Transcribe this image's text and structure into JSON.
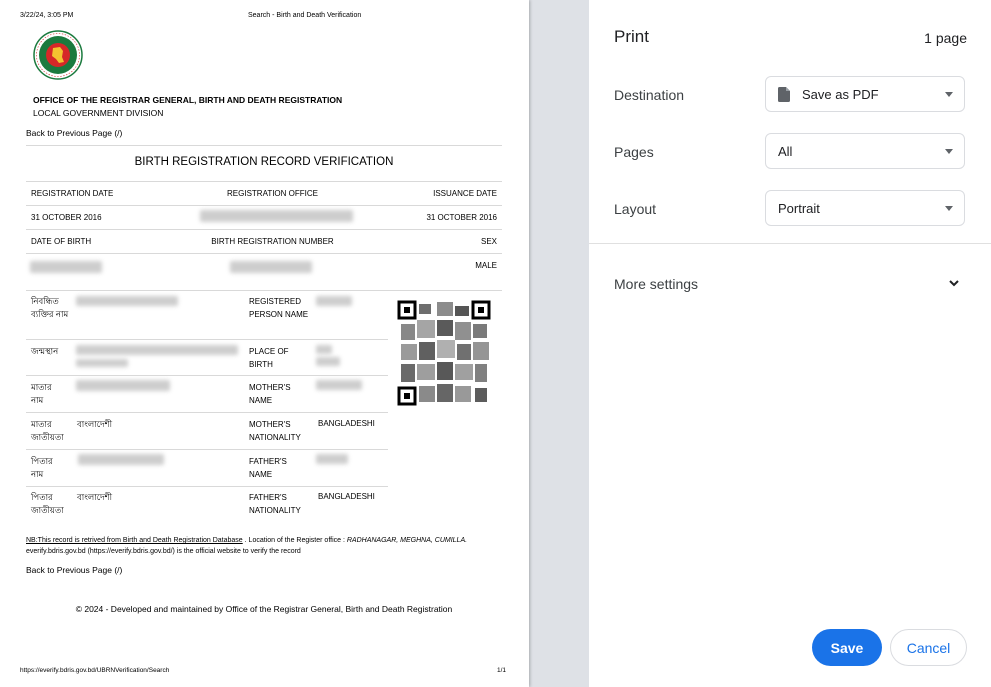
{
  "page": {
    "header_date": "3/22/24, 3:05 PM",
    "header_title": "Search - Birth and Death Verification",
    "office_title": "OFFICE OF THE REGISTRAR GENERAL, BIRTH AND DEATH REGISTRATION",
    "office_sub": "LOCAL GOVERNMENT DIVISION",
    "back_link": "Back to Previous Page (/)",
    "record_title": "BIRTH REGISTRATION RECORD VERIFICATION",
    "headers": {
      "registration_date": "REGISTRATION DATE",
      "registration_office": "REGISTRATION OFFICE",
      "issuance_date": "ISSUANCE DATE",
      "date_of_birth": "DATE OF BIRTH",
      "birth_reg_number": "BIRTH REGISTRATION NUMBER",
      "sex": "SEX"
    },
    "values": {
      "registration_date": "31 OCTOBER 2016",
      "issuance_date": "31 OCTOBER 2016",
      "sex": "MALE"
    },
    "details": [
      {
        "bn_label": "নিবন্ধিত ব্যক্তির নাম",
        "bn_value": "",
        "en_label": "REGISTERED PERSON NAME",
        "en_value": ""
      },
      {
        "bn_label": "জন্মস্থান",
        "bn_value": "",
        "en_label": "PLACE OF BIRTH",
        "en_value": ""
      },
      {
        "bn_label": "মাতার নাম",
        "bn_value": "",
        "en_label": "MOTHER'S NAME",
        "en_value": ""
      },
      {
        "bn_label": "মাতার জাতীয়তা",
        "bn_value": "বাংলাদেশী",
        "en_label": "MOTHER'S NATIONALITY",
        "en_value": "BANGLADESHI"
      },
      {
        "bn_label": "পিতার নাম",
        "bn_value": "",
        "en_label": "FATHER'S NAME",
        "en_value": ""
      },
      {
        "bn_label": "পিতার জাতীয়তা",
        "bn_value": "বাংলাদেশী",
        "en_label": "FATHER'S NATIONALITY",
        "en_value": "BANGLADESHI"
      }
    ],
    "nb_underlined": "NB:This record is retrived from Birth and Death Registration Database",
    "nb_mid": ". Location of the Register office :",
    "nb_location": "RADHANAGAR, MEGHNA, CUMILLA.",
    "nb_end": "everify.bdris.gov.bd (https://everify.bdris.gov.bd/) is the official website to verify the record",
    "back_link_bottom": "Back to Previous Page (/)",
    "copyright": "© 2024 - Developed and maintained by Office of the Registrar General, Birth and Death Registration",
    "footer_url": "https://everify.bdris.gov.bd/UBRNVerification/Search",
    "footer_page": "1/1"
  },
  "panel": {
    "title": "Print",
    "page_count": "1 page",
    "destination_label": "Destination",
    "destination_value": "Save as PDF",
    "pages_label": "Pages",
    "pages_value": "All",
    "layout_label": "Layout",
    "layout_value": "Portrait",
    "more_settings": "More settings",
    "save": "Save",
    "cancel": "Cancel"
  },
  "colors": {
    "accent": "#1a73e8",
    "preview_bg": "#dee1e6",
    "logo_green": "#1b7a3e",
    "logo_red": "#d62828"
  }
}
